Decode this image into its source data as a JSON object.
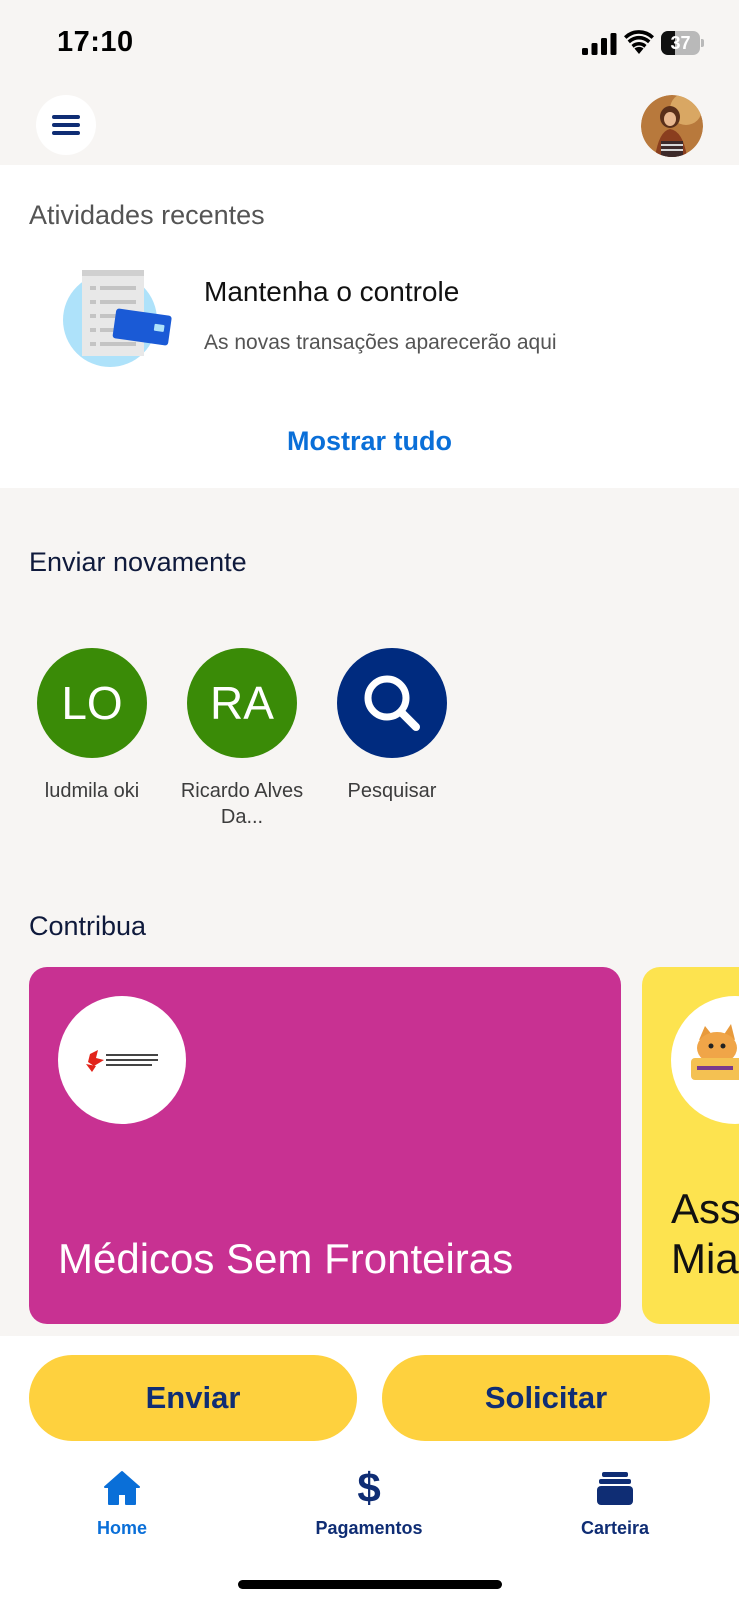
{
  "status_bar": {
    "time": "17:10",
    "battery": "37",
    "battery_level": 0.37
  },
  "header": {
    "menu_icon": "hamburger-menu-icon",
    "avatar_icon": "profile-avatar"
  },
  "recent": {
    "title": "Atividades recentes",
    "illustration_icon": "transactions-receipt-card-icon",
    "heading": "Mantenha o controle",
    "subtitle": "As novas transações aparecerão aqui",
    "show_all": "Mostrar tudo"
  },
  "send_again": {
    "title": "Enviar novamente",
    "contacts": [
      {
        "initials": "LO",
        "name": "ludmila oki",
        "color": "#3a8b07"
      },
      {
        "initials": "RA",
        "name": "Ricardo Alves Da...",
        "color": "#3a8b07"
      }
    ],
    "search": {
      "label": "Pesquisar",
      "icon": "search-icon",
      "color": "#002b7f"
    }
  },
  "contribute": {
    "title": "Contribua",
    "cards": [
      {
        "name": "Médicos Sem Fronteiras",
        "color": "#c83192"
      },
      {
        "name": "Ass Mia",
        "color": "#fde34f"
      }
    ]
  },
  "actions": {
    "send": "Enviar",
    "request": "Solicitar"
  },
  "tabs": [
    {
      "label": "Home",
      "icon": "home-icon",
      "active": true,
      "color": "#0a6fd8"
    },
    {
      "label": "Pagamentos",
      "icon": "dollar-icon",
      "active": false,
      "color": "#0f2d74"
    },
    {
      "label": "Carteira",
      "icon": "wallet-icon",
      "active": false,
      "color": "#0f2d74"
    }
  ]
}
